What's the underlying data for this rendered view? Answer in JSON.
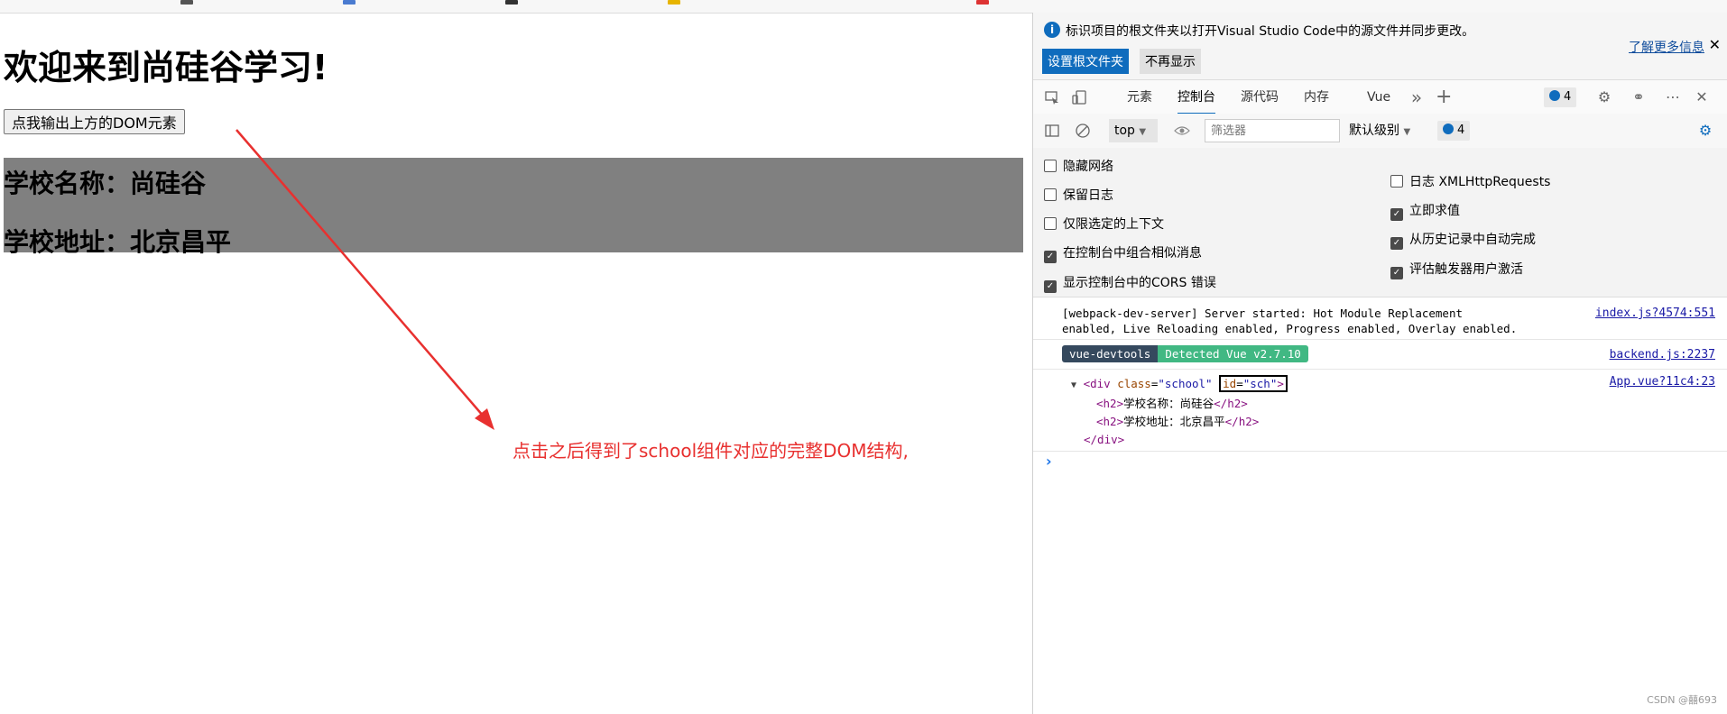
{
  "page": {
    "heading": "欢迎来到尚硅谷学习!",
    "button_label": "点我输出上方的DOM元素",
    "school_name": "学校名称：尚硅谷",
    "school_address": "学校地址：北京昌平",
    "annotation": "点击之后得到了school组件对应的完整DOM结构,"
  },
  "devtools": {
    "infobar": {
      "message": "标识项目的根文件夹以打开Visual Studio Code中的源文件并同步更改。",
      "primary_button": "设置根文件夹",
      "secondary_button": "不再显示",
      "learn_more": "了解更多信息",
      "close": "✕"
    },
    "tabs": [
      {
        "label": "元素"
      },
      {
        "label": "控制台",
        "active": true
      },
      {
        "label": "源代码"
      },
      {
        "label": "内存"
      },
      {
        "label": "Vue"
      }
    ],
    "message_count": "4",
    "toolbar": {
      "context": "top",
      "filter_placeholder": "筛选器",
      "level": "默认级别",
      "issues_count": "4"
    },
    "settings_left": [
      {
        "label": "隐藏网络",
        "checked": false
      },
      {
        "label": "保留日志",
        "checked": false
      },
      {
        "label": "仅限选定的上下文",
        "checked": false
      },
      {
        "label": "在控制台中组合相似消息",
        "checked": true
      },
      {
        "label": "显示控制台中的CORS 错误",
        "checked": true
      }
    ],
    "settings_right": [
      {
        "label": "日志 XMLHttpRequests",
        "checked": false
      },
      {
        "label": "立即求值",
        "checked": true
      },
      {
        "label": "从历史记录中自动完成",
        "checked": true
      },
      {
        "label": "评估触发器用户激活",
        "checked": true
      }
    ],
    "console": {
      "msg1_line1": "[webpack-dev-server] Server started: Hot Module Replacement",
      "msg1_line2": "enabled, Live Reloading enabled, Progress enabled, Overlay enabled.",
      "msg1_source": "index.js?4574:551",
      "vue_tag": "vue-devtools",
      "vue_detected": "Detected Vue v2.7.10",
      "msg2_source": "backend.js:2237",
      "dom_open_tag": "div",
      "dom_class_attr": "class",
      "dom_class_val": "\"school\"",
      "dom_id_attr": "id",
      "dom_id_val": "\"sch\"",
      "dom_child1": "学校名称：尚硅谷",
      "dom_child2": "学校地址：北京昌平",
      "dom_child_tag": "h2",
      "dom_close": "</div>",
      "msg3_source": "App.vue?11c4:23"
    },
    "watermark": "CSDN @囍693"
  },
  "colors": {
    "accent": "#0f6cbd",
    "annotation": "#e8302f",
    "school_bg": "#808080",
    "vue_dark": "#35495e",
    "vue_green": "#41b883"
  }
}
